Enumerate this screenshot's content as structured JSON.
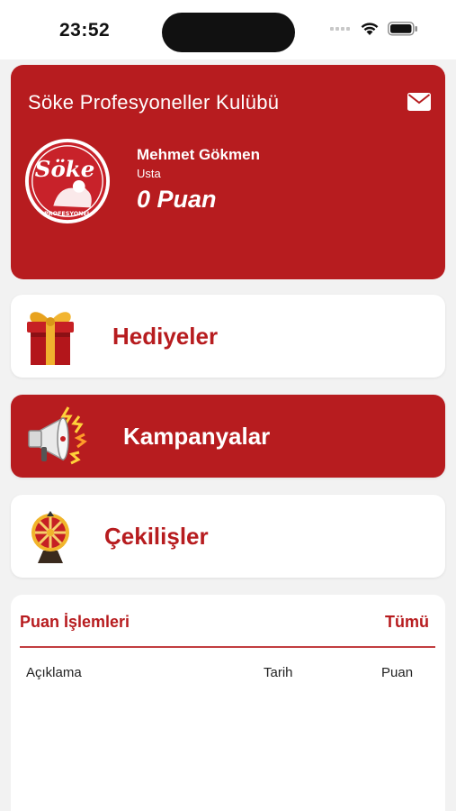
{
  "status_bar": {
    "time": "23:52",
    "icons": [
      "signal-icon",
      "wifi-icon",
      "battery-icon"
    ]
  },
  "header": {
    "title": "Söke Profesyoneller Kulübü",
    "logo_text": "Söke",
    "logo_subtext": "PROFESYONEL",
    "member_name": "Mehmet Gökmen",
    "member_level": "Usta",
    "points": "0 Puan",
    "mail_icon": "mail-icon"
  },
  "menu": {
    "gifts": {
      "label": "Hediyeler",
      "icon": "gift-icon"
    },
    "campaigns": {
      "label": "Kampanyalar",
      "icon": "megaphone-icon"
    },
    "draws": {
      "label": "Çekilişler",
      "icon": "prize-wheel-icon"
    }
  },
  "points_history": {
    "title": "Puan İşlemleri",
    "see_all": "Tümü",
    "columns": [
      "Açıklama",
      "Tarih",
      "Puan"
    ]
  },
  "colors": {
    "brand_red": "#b71c1f",
    "background": "#f2f2f2",
    "card": "#ffffff"
  }
}
